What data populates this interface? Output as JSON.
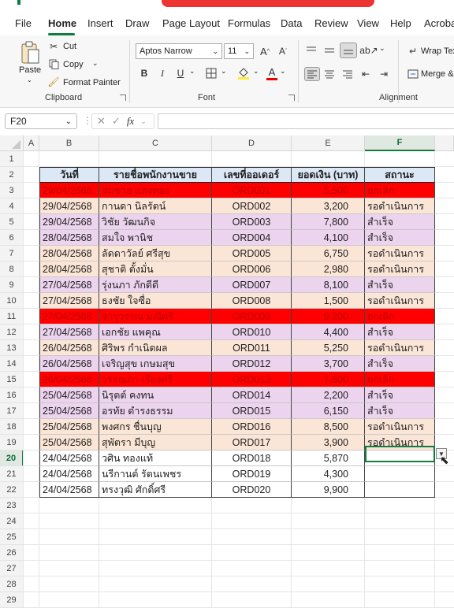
{
  "menu": [
    "File",
    "Home",
    "Insert",
    "Draw",
    "Page Layout",
    "Formulas",
    "Data",
    "Review",
    "View",
    "Help",
    "Acrobat"
  ],
  "ribbon": {
    "clipboard": {
      "paste": "Paste",
      "cut": "Cut",
      "copy": "Copy",
      "format_painter": "Format Painter",
      "label": "Clipboard"
    },
    "font": {
      "name": "Aptos Narrow",
      "size": "11",
      "label": "Font",
      "bold": "B",
      "italic": "I",
      "underline": "U"
    },
    "alignment": {
      "wrap": "Wrap Text",
      "merge": "Merge &",
      "label": "Alignment"
    }
  },
  "formula_bar": {
    "name_box": "F20",
    "fx": "fx",
    "value": ""
  },
  "columns": [
    "A",
    "B",
    "C",
    "D",
    "E",
    "F"
  ],
  "rows": [
    "1",
    "2",
    "3",
    "4",
    "5",
    "6",
    "7",
    "8",
    "9",
    "10",
    "11",
    "12",
    "13",
    "14",
    "15",
    "16",
    "17",
    "18",
    "19",
    "20",
    "21",
    "22",
    "23",
    "24",
    "25",
    "26",
    "27",
    "28",
    "29"
  ],
  "selected": {
    "col": "F",
    "row": "20"
  },
  "table": {
    "headers": [
      "วันที่",
      "รายชื่อพนักงานขาย",
      "เลขที่ออเดอร์",
      "ยอดเงิน (บาท)",
      "สถานะ"
    ],
    "rows": [
      {
        "date": "29/04/2568",
        "name": "สมชาย แสงทอง",
        "order": "ORD001",
        "amount": "5,500",
        "status": "ยกเลิก",
        "style": "cancel"
      },
      {
        "date": "29/04/2568",
        "name": "กานดา นิลรัตน์",
        "order": "ORD002",
        "amount": "3,200",
        "status": "รอดำเนินการ",
        "style": "pending"
      },
      {
        "date": "29/04/2568",
        "name": "วิชัย วัฒนกิจ",
        "order": "ORD003",
        "amount": "7,800",
        "status": "สำเร็จ",
        "style": "done"
      },
      {
        "date": "28/04/2568",
        "name": "สมใจ พานิช",
        "order": "ORD004",
        "amount": "4,100",
        "status": "สำเร็จ",
        "style": "done"
      },
      {
        "date": "28/04/2568",
        "name": "ลัดดาวัลย์ ศรีสุข",
        "order": "ORD005",
        "amount": "6,750",
        "status": "รอดำเนินการ",
        "style": "pending"
      },
      {
        "date": "28/04/2568",
        "name": "สุชาติ ตั้งมั่น",
        "order": "ORD006",
        "amount": "2,980",
        "status": "รอดำเนินการ",
        "style": "pending"
      },
      {
        "date": "27/04/2568",
        "name": "รุ่งนภา ภักดีดี",
        "order": "ORD007",
        "amount": "8,100",
        "status": "สำเร็จ",
        "style": "done"
      },
      {
        "date": "27/04/2568",
        "name": "ธงชัย ใจซื่อ",
        "order": "ORD008",
        "amount": "1,500",
        "status": "รอดำเนินการ",
        "style": "pending"
      },
      {
        "date": "27/04/2568",
        "name": "จารุวรรณ มณีศรี",
        "order": "ORD009",
        "amount": "9,200",
        "status": "ยกเลิก",
        "style": "cancel"
      },
      {
        "date": "27/04/2568",
        "name": "เอกชัย แพคุณ",
        "order": "ORD010",
        "amount": "4,400",
        "status": "สำเร็จ",
        "style": "done"
      },
      {
        "date": "26/04/2568",
        "name": "ศิริพร กำเนิดผล",
        "order": "ORD011",
        "amount": "5,250",
        "status": "รอดำเนินการ",
        "style": "pending"
      },
      {
        "date": "26/04/2568",
        "name": "เจริญสุข เกษมสุข",
        "order": "ORD012",
        "amount": "3,700",
        "status": "สำเร็จ",
        "style": "done"
      },
      {
        "date": "26/04/2568",
        "name": "วรรณภา เรืองศรี",
        "order": "ORD013",
        "amount": "7,600",
        "status": "ยกเลิก",
        "style": "cancel"
      },
      {
        "date": "25/04/2568",
        "name": "นิรุตต์ คงทน",
        "order": "ORD014",
        "amount": "2,200",
        "status": "สำเร็จ",
        "style": "done"
      },
      {
        "date": "25/04/2568",
        "name": "อรทัย ดำรงธรรม",
        "order": "ORD015",
        "amount": "6,150",
        "status": "สำเร็จ",
        "style": "done"
      },
      {
        "date": "25/04/2568",
        "name": "พงศกร ชื่นบุญ",
        "order": "ORD016",
        "amount": "8,500",
        "status": "รอดำเนินการ",
        "style": "pending"
      },
      {
        "date": "25/04/2568",
        "name": "สุพัตรา มีบุญ",
        "order": "ORD017",
        "amount": "3,900",
        "status": "รอดำเนินการ",
        "style": "pending"
      },
      {
        "date": "24/04/2568",
        "name": "วศิน ทองแท้",
        "order": "ORD018",
        "amount": "5,870",
        "status": "",
        "style": "none"
      },
      {
        "date": "24/04/2568",
        "name": "นรีกานต์ รัตนเพชร",
        "order": "ORD019",
        "amount": "4,300",
        "status": "",
        "style": "none"
      },
      {
        "date": "24/04/2568",
        "name": "ทรงวุฒิ ศักดิ์ศรี",
        "order": "ORD020",
        "amount": "9,900",
        "status": "",
        "style": "none"
      }
    ]
  },
  "colors": {
    "cancel_bg": "#ff0000",
    "cancel_text": "#c00000",
    "pending_bg": "#fbe5d6",
    "done_bg": "#ecd3ee",
    "header_bg": "#dde8f7",
    "accent": "#107c41"
  }
}
